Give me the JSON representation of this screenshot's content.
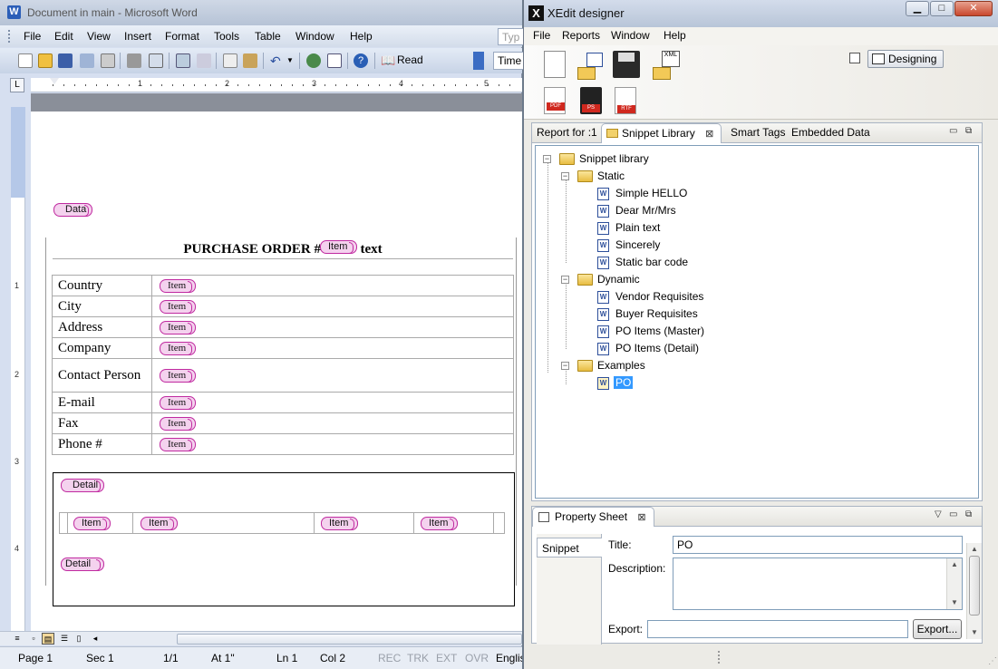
{
  "word": {
    "title": "Document in main - Microsoft Word",
    "icon_letter": "W",
    "menu": [
      "File",
      "Edit",
      "View",
      "Insert",
      "Format",
      "Tools",
      "Table",
      "Window",
      "Help"
    ],
    "type_question": "Typ",
    "read_label": "Read",
    "font_name": "Time",
    "ruler_numbers": [
      "1",
      "2",
      "3",
      "4",
      "5"
    ],
    "vruler_numbers": [
      "1",
      "2",
      "3",
      "4"
    ],
    "tab_selector": "L",
    "doc": {
      "data_tag": "Data",
      "po_title": "PURCHASE ORDER #",
      "po_title_tag": "Item",
      "po_title_suffix": "text",
      "rows": [
        {
          "label": "Country",
          "tag": "Item"
        },
        {
          "label": "City",
          "tag": "Item"
        },
        {
          "label": "Address",
          "tag": "Item"
        },
        {
          "label": "Company",
          "tag": "Item"
        },
        {
          "label": "Contact Person",
          "tag": "Item"
        },
        {
          "label": "E-mail",
          "tag": "Item"
        },
        {
          "label": "Fax",
          "tag": "Item"
        },
        {
          "label": "Phone #",
          "tag": "Item"
        }
      ],
      "detail_start": "Detail",
      "detail_items": [
        "Item",
        "Item",
        "Item",
        "Item"
      ],
      "detail_end": "Detail"
    },
    "status": {
      "page": "Page 1",
      "sec": "Sec 1",
      "pages": "1/1",
      "at": "At 1\"",
      "ln": "Ln 1",
      "col": "Col 2",
      "rec": "REC",
      "trk": "TRK",
      "ext": "EXT",
      "ovr": "OVR",
      "lang": "Englis"
    }
  },
  "xedit": {
    "title": "XEdit designer",
    "logo": "X",
    "menu": [
      "File",
      "Reports",
      "Window",
      "Help"
    ],
    "designing_label": "Designing",
    "tabs": {
      "report_for": "Report for :1",
      "snippet_library": "Snippet Library",
      "smart_tags": "Smart Tags",
      "embedded_data": "Embedded Data"
    },
    "tree": {
      "root": "Snippet library",
      "static": {
        "label": "Static",
        "items": [
          "Simple HELLO",
          "Dear Mr/Mrs",
          "Plain text",
          "Sincerely",
          "Static bar code"
        ]
      },
      "dynamic": {
        "label": "Dynamic",
        "items": [
          "Vendor Requisites",
          "Buyer Requisites",
          "PO Items (Master)",
          "PO Items (Detail)"
        ]
      },
      "examples": {
        "label": "Examples",
        "items": [
          "PO"
        ]
      }
    },
    "property_sheet": {
      "tab": "Property Sheet",
      "side_tab": "Snippet",
      "title_label": "Title:",
      "title_value": "PO",
      "description_label": "Description:",
      "description_value": "",
      "export_label": "Export:",
      "export_value": "",
      "export_button": "Export..."
    },
    "icon_labels": {
      "pdf": "PDF",
      "ps": "PS",
      "rtf": "RTF",
      "xml": "XML"
    }
  }
}
